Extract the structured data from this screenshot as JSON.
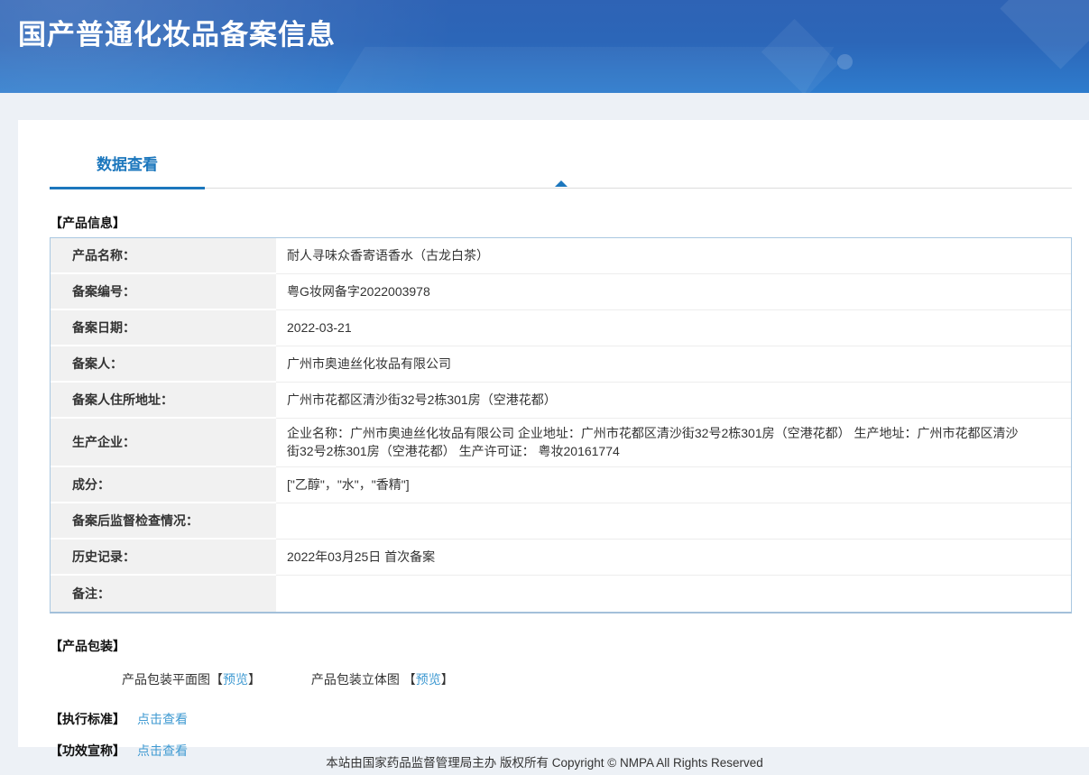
{
  "header": {
    "title": "国产普通化妆品备案信息"
  },
  "tabs": {
    "data_view": "数据查看"
  },
  "sections": {
    "product_info_title": "【产品信息】",
    "packaging_title": "【产品包装】",
    "standard_title": "【执行标准】",
    "efficacy_title": "【功效宣称】"
  },
  "product_table": {
    "rows": [
      {
        "label": "产品名称：",
        "value": "耐人寻味众香寄语香水（古龙白茶）"
      },
      {
        "label": "备案编号：",
        "value": "粤G妆网备字2022003978"
      },
      {
        "label": "备案日期：",
        "value": "2022-03-21"
      },
      {
        "label": "备案人：",
        "value": "广州市奥迪丝化妆品有限公司"
      },
      {
        "label": "备案人住所地址：",
        "value": "广州市花都区清沙街32号2栋301房（空港花都）"
      },
      {
        "label": "生产企业：",
        "value": "企业名称：广州市奥迪丝化妆品有限公司 企业地址：广州市花都区清沙街32号2栋301房（空港花都） 生产地址：广州市花都区清沙街32号2栋301房（空港花都） 生产许可证： 粤妆20161774"
      },
      {
        "label": "成分：",
        "value": "[\"乙醇\"，\"水\"，\"香精\"]"
      },
      {
        "label": "备案后监督检查情况：",
        "value": ""
      },
      {
        "label": "历史记录：",
        "value": "2022年03月25日 首次备案"
      },
      {
        "label": "备注：",
        "value": ""
      }
    ]
  },
  "packaging": {
    "items": [
      {
        "prefix": "产品包装平面图【",
        "link": "预览",
        "suffix": "】"
      },
      {
        "prefix": "产品包装立体图 【",
        "link": "预览",
        "suffix": "】"
      }
    ]
  },
  "standard": {
    "link": "点击查看"
  },
  "efficacy": {
    "link": "点击查看"
  },
  "footer": {
    "text": "本站由国家药品监督管理局主办 版权所有 Copyright © NMPA All Rights Reserved"
  },
  "colors": {
    "accent_blue": "#1c77bd",
    "link_blue": "#3f9ad2",
    "banner_top": "#2e63b5",
    "banner_bottom": "#2e7ccd",
    "table_border": "#aac8e1",
    "label_cell_bg": "#f1f1f1"
  }
}
